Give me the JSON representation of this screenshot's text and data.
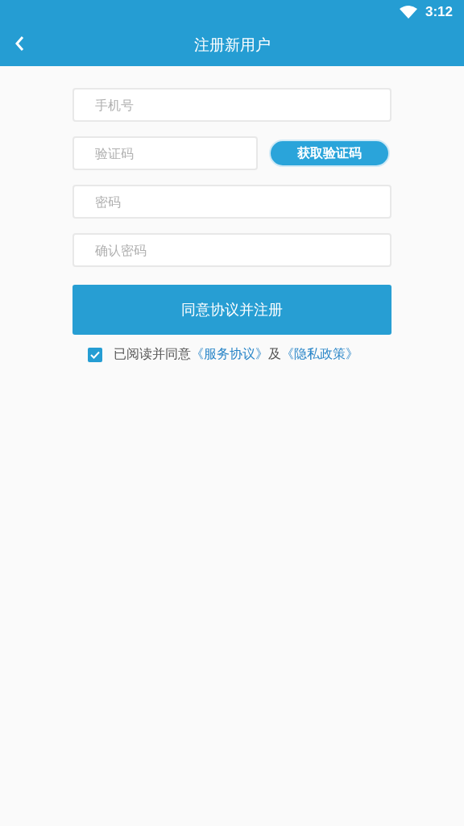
{
  "status_bar": {
    "time": "3:12"
  },
  "header": {
    "title": "注册新用户"
  },
  "fields": [
    {
      "kind": "phone",
      "placeholder": "手机号"
    },
    {
      "kind": "code",
      "placeholder": "验证码",
      "button": "获取验证码"
    },
    {
      "kind": "password",
      "placeholder": "密码"
    },
    {
      "kind": "password",
      "placeholder": "确认密码"
    }
  ],
  "submit_button": "同意协议并注册",
  "agreement": {
    "checked": true,
    "text": "已阅读并同意",
    "link_1": "《服务协议》",
    "joiner": "及",
    "link_2": "《隐私政策》"
  }
}
